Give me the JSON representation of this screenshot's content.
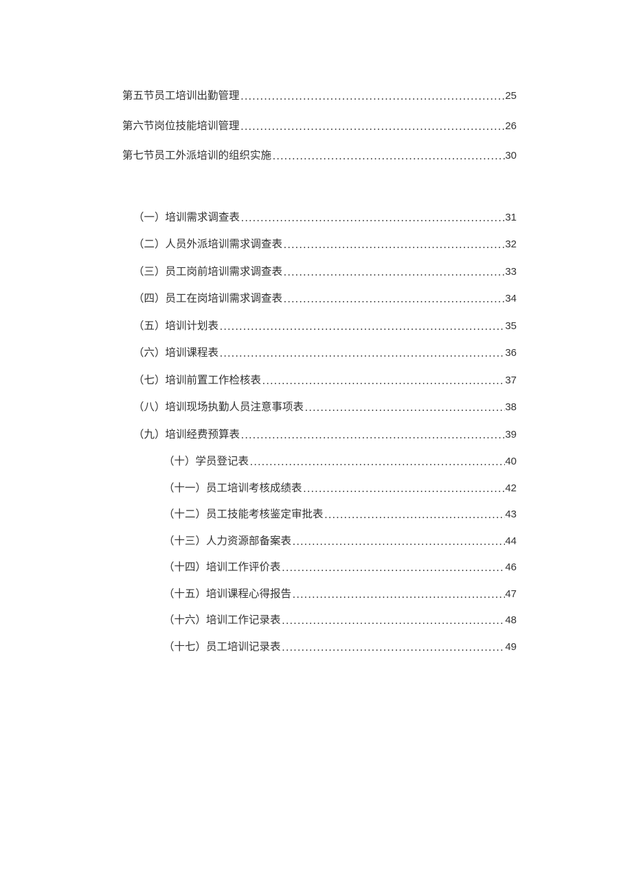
{
  "toc": {
    "group1": [
      {
        "label": "第五节员工培训出勤管理",
        "page": "25"
      },
      {
        "label": "第六节岗位技能培训管理",
        "page": "26"
      },
      {
        "label": "第七节员工外派培训的组织实施",
        "page": "30"
      }
    ],
    "group2": [
      {
        "label": "（一）培训需求调查表 ",
        "page": "31"
      },
      {
        "label": "（二）人员外派培训需求调查表 ",
        "page": "32"
      },
      {
        "label": "（三）员工岗前培训需求调查表 ",
        "page": "33"
      },
      {
        "label": "（四）员工在岗培训需求调查表 ",
        "page": "34"
      },
      {
        "label": "（五）培训计划表 ",
        "page": "35"
      },
      {
        "label": "（六）培训课程表 ",
        "page": "36"
      },
      {
        "label": "（七）培训前置工作检核表 ",
        "page": "37"
      },
      {
        "label": "（八）培训现场执勤人员注意事项表 ",
        "page": "38"
      },
      {
        "label": "（九）培训经费预算表 ",
        "page": "39"
      }
    ],
    "group3": [
      {
        "label": "（十）学员登记表 ",
        "page": "40"
      },
      {
        "label": "（十一）员工培训考核成绩表 ",
        "page": "42"
      },
      {
        "label": "（十二）员工技能考核鉴定审批表 ",
        "page": "43"
      },
      {
        "label": "（十三）人力资源部备案表 ",
        "page": "44"
      },
      {
        "label": "（十四）培训工作评价表 ",
        "page": "46"
      },
      {
        "label": "（十五）培训课程心得报告 ",
        "page": "47"
      },
      {
        "label": "（十六）培训工作记录表 ",
        "page": "48"
      },
      {
        "label": "（十七）员工培训记录表 ",
        "page": "49"
      }
    ]
  }
}
